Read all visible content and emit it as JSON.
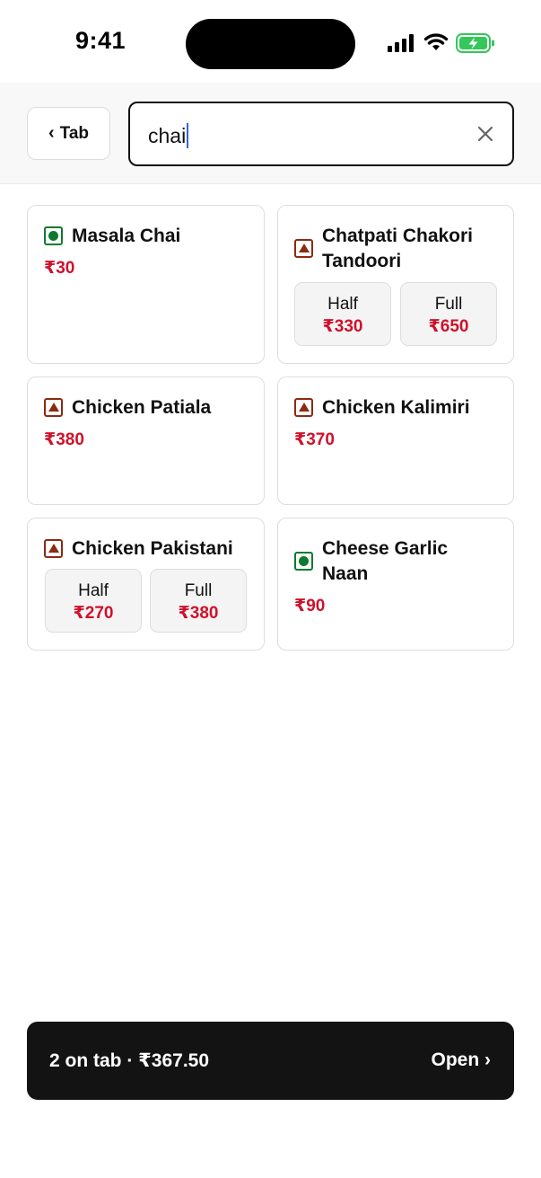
{
  "status": {
    "time": "9:41"
  },
  "header": {
    "back_label": "Tab",
    "search": {
      "value": "chai",
      "placeholder": ""
    }
  },
  "results": [
    {
      "name": "Masala Chai",
      "diet": "veg",
      "price": "₹30",
      "variants": []
    },
    {
      "name_lines": [
        "Chatpati Chakori",
        "Tandoori"
      ],
      "diet": "nonveg",
      "variants": [
        {
          "label": "Half",
          "price": "₹330"
        },
        {
          "label": "Full",
          "price": "₹650"
        }
      ]
    },
    {
      "name": "Chicken Patiala",
      "diet": "nonveg",
      "price": "₹380",
      "variants": []
    },
    {
      "name": "Chicken Kalimiri",
      "diet": "nonveg",
      "price": "₹370",
      "variants": []
    },
    {
      "name": "Chicken Pakistani",
      "diet": "nonveg",
      "variants": [
        {
          "label": "Half",
          "price": "₹270"
        },
        {
          "label": "Full",
          "price": "₹380"
        }
      ]
    },
    {
      "name_lines": [
        "Cheese Garlic",
        "Naan"
      ],
      "diet": "veg",
      "price": "₹90",
      "variants": []
    }
  ],
  "tab_bar": {
    "summary": "2 on tab · ₹367.50",
    "open_label": "Open ›"
  },
  "colors": {
    "veg": "#0e7a2f",
    "nonveg": "#8a2b12",
    "price": "#d0112b",
    "battery": "#34c759"
  },
  "icons": [
    "signal-icon",
    "wifi-icon",
    "battery-charging-icon",
    "chevron-left-icon",
    "clear-icon",
    "veg-indicator-icon",
    "nonveg-indicator-icon"
  ]
}
